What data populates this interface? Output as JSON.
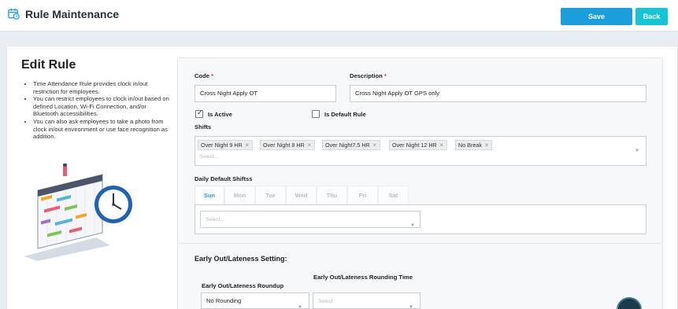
{
  "header": {
    "title": "Rule Maintenance",
    "save_label": "Save",
    "back_label": "Back"
  },
  "left": {
    "title": "Edit Rule",
    "bullets": [
      "Time Attendance Rule provides clock in/out restriction for employees.",
      "You can restrict employees to clock in/out based on defined Location, Wi-Fi Connection, and/or Bluetooth accessibilities.",
      "You can also ask employees to take a photo from clock in/out environment or use face recognition as addition."
    ]
  },
  "form": {
    "code_label": "Code",
    "code_value": "Cross Night Apply OT",
    "description_label": "Description",
    "description_value": "Cross Night Apply OT GPS  only",
    "required_mark": "*",
    "is_active_label": "Is Active",
    "is_active_checked": true,
    "is_default_label": "Is Default Rule",
    "is_default_checked": false,
    "shifts_label": "Shifts",
    "shifts": [
      "Over Night 9 HR",
      "Over Night 8 HR",
      "Over Night7.5 HR",
      "Over Night 12 HR",
      "No Break"
    ],
    "shifts_placeholder": "Select...",
    "daily_label": "Daily Default Shiftss",
    "days": [
      "Sun",
      "Mon",
      "Tue",
      "Wed",
      "Thu",
      "Fri",
      "Sat"
    ],
    "active_day": "Sun",
    "daily_placeholder": "Select...",
    "early_section_title": "Early Out/Lateness Setting:",
    "roundup_label": "Early Out/Lateness Roundup",
    "roundup_value": "No Rounding",
    "rounding_time_label": "Early Out/Lateness Rounding Time",
    "rounding_time_placeholder": "Select"
  },
  "icons": {
    "app": "calendar-icon",
    "remove": "close-icon",
    "dropdown": "chevron-down-icon"
  },
  "colors": {
    "primary": "#1b9fdc",
    "back": "#12c6d6",
    "required": "#e53935"
  }
}
